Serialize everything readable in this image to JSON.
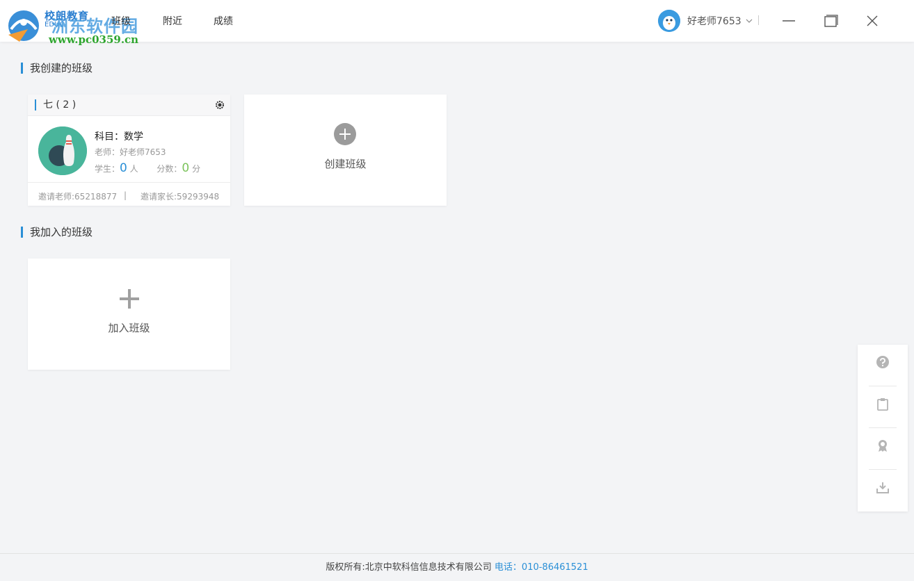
{
  "app": {
    "logo_title": "校朗教育",
    "logo_sub": "EDUC",
    "watermark_text": "洲东软件园",
    "watermark_url": "www.pc0359.cn"
  },
  "nav": {
    "items": [
      {
        "label": "班级"
      },
      {
        "label": "附近"
      },
      {
        "label": "成绩"
      }
    ]
  },
  "user": {
    "name": "好老师7653"
  },
  "sections": {
    "created_title": "我创建的班级",
    "joined_title": "我加入的班级"
  },
  "class_card": {
    "name": "七 ( 2 )",
    "subject": "科目：数学",
    "teacher": "老师：好老师7653",
    "students_label": "学生：",
    "students_count": "0",
    "students_unit": "人",
    "score_label": "分数：",
    "score_value": "0",
    "score_unit": "分",
    "invite_teacher": "邀请老师:65218877",
    "divider": "|",
    "invite_parent": "邀请家长:59293948"
  },
  "actions": {
    "create_class": "创建班级",
    "join_class": "加入班级"
  },
  "side_tools": [
    "help-icon",
    "clipboard-icon",
    "award-icon",
    "download-icon"
  ],
  "footer": {
    "copyright": "版权所有:北京中软科信信息技术有限公司",
    "phone": "电话：010-86461521"
  },
  "colors": {
    "accent": "#2a8fd6",
    "green": "#7cc35c",
    "avatar_bg": "#49b59b"
  }
}
